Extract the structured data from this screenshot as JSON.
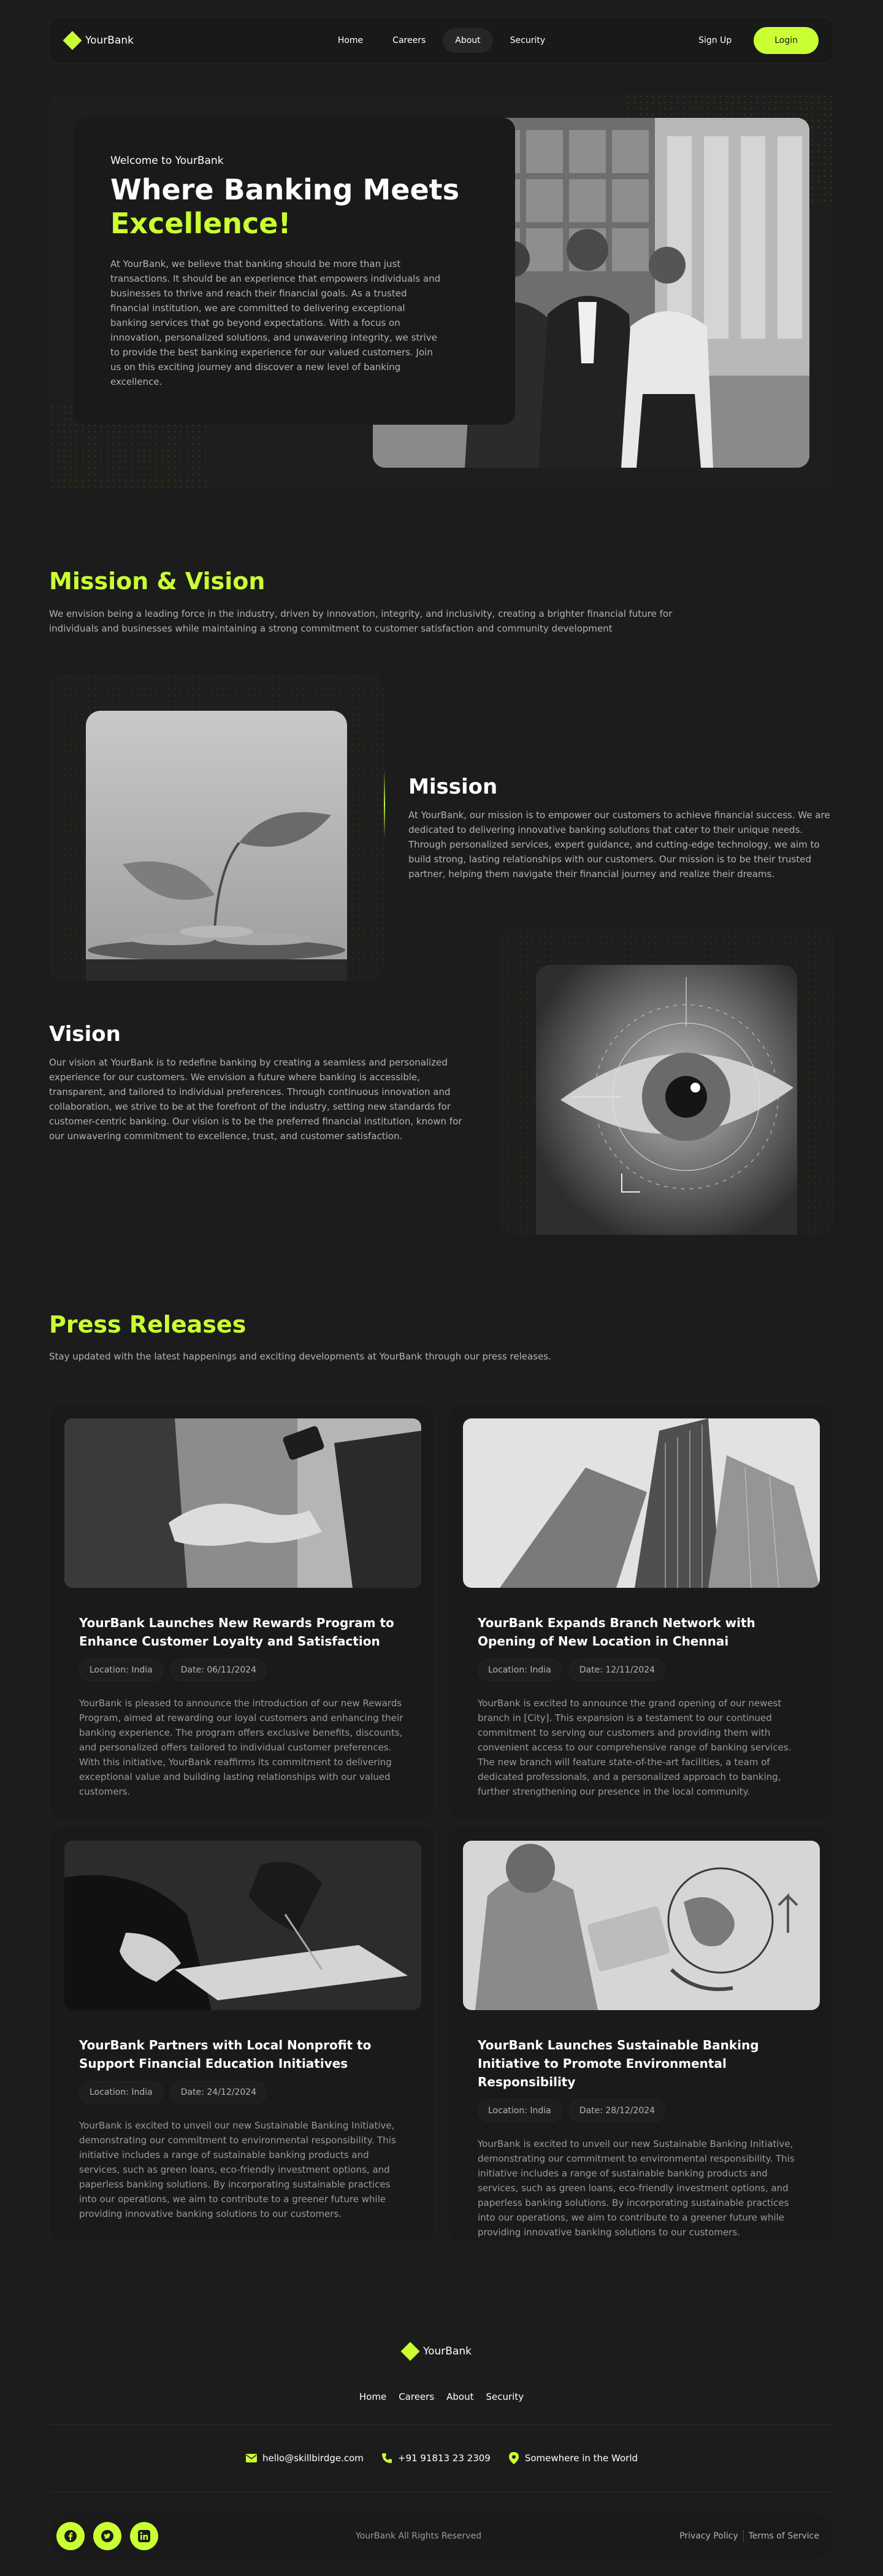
{
  "nav": {
    "brand": "YourBank",
    "links": [
      {
        "label": "Home",
        "active": false
      },
      {
        "label": "Careers",
        "active": false
      },
      {
        "label": "About",
        "active": true
      },
      {
        "label": "Security",
        "active": false
      }
    ],
    "signup_label": "Sign Up",
    "login_label": "Login"
  },
  "hero": {
    "welcome": "Welcome to YourBank",
    "title_line1": "Where Banking Meets",
    "title_line2": "Excellence!",
    "text": "At YourBank, we believe that banking should be more than just transactions. It should be an experience that empowers individuals and businesses to thrive and reach their financial goals. As a trusted financial institution, we are committed to delivering exceptional banking services that go beyond expectations. With a focus on innovation, personalized solutions, and unwavering integrity, we strive to provide the best banking experience for our valued customers. Join us on this exciting journey and discover a new level of banking excellence."
  },
  "mission_vision": {
    "title": "Mission & Vision",
    "description": "We envision being a leading force in the industry, driven by innovation, integrity, and inclusivity, creating a brighter financial future for individuals and businesses while maintaining a strong commitment to customer satisfaction and community development",
    "mission": {
      "title": "Mission",
      "text": "At YourBank, our mission is to empower our customers to achieve financial success. We are dedicated to delivering innovative banking solutions that cater to their unique needs. Through personalized services, expert guidance, and cutting-edge technology, we aim to build strong, lasting relationships with our customers. Our mission is to be their trusted partner, helping them navigate their financial journey and realize their dreams."
    },
    "vision": {
      "title": "Vision",
      "text": "Our vision at YourBank is to redefine banking by creating a seamless and personalized experience for our customers. We envision a future where banking is accessible, transparent, and tailored to individual preferences. Through continuous innovation and collaboration, we strive to be at the forefront of the industry, setting new standards for customer-centric banking. Our vision is to be the preferred financial institution, known for our unwavering commitment to excellence, trust, and customer satisfaction."
    }
  },
  "press": {
    "title": "Press Releases",
    "description": "Stay updated with the latest happenings and exciting developments at YourBank through our press releases.",
    "items": [
      {
        "title": "YourBank Launches New Rewards Program to Enhance Customer Loyalty and Satisfaction",
        "location": "Location: India",
        "date": "Date: 06/11/2024",
        "text": "YourBank is pleased to announce the introduction of our new Rewards Program, aimed at rewarding our loyal customers and enhancing their banking experience. The program offers exclusive benefits, discounts, and personalized offers tailored to individual customer preferences. With this initiative, YourBank reaffirms its commitment to delivering exceptional value and building lasting relationships with our valued customers."
      },
      {
        "title": "YourBank Expands Branch Network with Opening of New Location in Chennai",
        "location": "Location: India",
        "date": "Date: 12/11/2024",
        "text": "YourBank is excited to announce the grand opening of our newest branch in [City]. This expansion is a testament to our continued commitment to serving our customers and providing them with convenient access to our comprehensive range of banking services. The new branch will feature state-of-the-art facilities, a team of dedicated professionals, and a personalized approach to banking, further strengthening our presence in the local community."
      },
      {
        "title": "YourBank Partners with Local Nonprofit to Support Financial Education Initiatives",
        "location": "Location: India",
        "date": "Date: 24/12/2024",
        "text": "YourBank is excited to unveil our new Sustainable Banking Initiative, demonstrating our commitment to environmental responsibility. This initiative includes a range of sustainable banking products and services, such as green loans, eco-friendly investment options, and paperless banking solutions. By incorporating sustainable practices into our operations, we aim to contribute to a greener future while providing innovative banking solutions to our customers."
      },
      {
        "title": "YourBank Launches Sustainable Banking Initiative to Promote Environmental Responsibility",
        "location": "Location: India",
        "date": "Date: 28/12/2024",
        "text": "YourBank is excited to unveil our new Sustainable Banking Initiative, demonstrating our commitment to environmental responsibility. This initiative includes a range of sustainable banking products and services, such as green loans, eco-friendly investment options, and paperless banking solutions. By incorporating sustainable practices into our operations, we aim to contribute to a greener future while providing innovative banking solutions to our customers."
      }
    ]
  },
  "footer": {
    "brand": "YourBank",
    "links": [
      "Home",
      "Careers",
      "About",
      "Security"
    ],
    "email": "hello@skillbirdge.com",
    "phone": "+91 91813 23 2309",
    "address": "Somewhere in the World",
    "copyright": "YourBank All Rights Reserved",
    "privacy": "Privacy Policy",
    "terms": "Terms of Service",
    "socials": [
      "facebook-icon",
      "twitter-icon",
      "linkedin-icon"
    ]
  },
  "colors": {
    "accent": "#caff33",
    "background": "#1c1c1c"
  }
}
